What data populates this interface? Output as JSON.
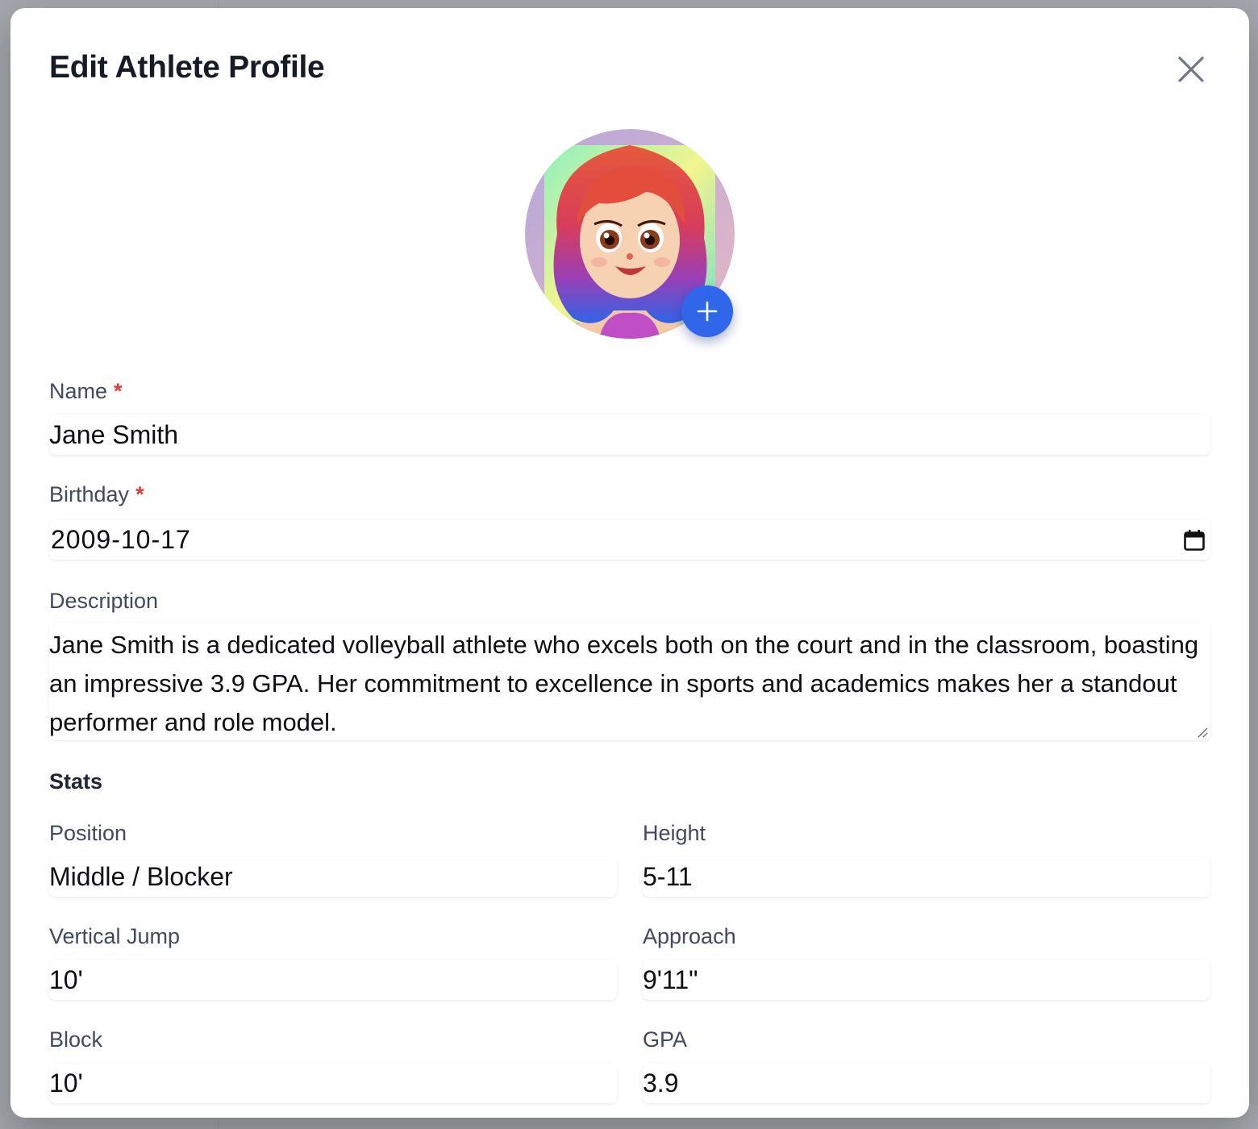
{
  "modal": {
    "title": "Edit Athlete Profile"
  },
  "avatar": {
    "add_icon": "plus-icon",
    "close_icon": "close-icon"
  },
  "form": {
    "name": {
      "label": "Name",
      "required_mark": "*",
      "value": "Jane Smith"
    },
    "birthday": {
      "label": "Birthday",
      "required_mark": "*",
      "value": "2009-10-17",
      "icon": "calendar-icon"
    },
    "description": {
      "label": "Description",
      "value": "Jane Smith is a dedicated volleyball athlete who excels both on the court and in the classroom, boasting an impressive 3.9 GPA. Her commitment to excellence in sports and academics makes her a standout performer and role model."
    }
  },
  "stats": {
    "title": "Stats",
    "position": {
      "label": "Position",
      "value": "Middle / Blocker"
    },
    "height": {
      "label": "Height",
      "value": "5-11"
    },
    "vertical_jump": {
      "label": "Vertical Jump",
      "value": "10'"
    },
    "approach": {
      "label": "Approach",
      "value": "9'11\""
    },
    "block": {
      "label": "Block",
      "value": "10'"
    },
    "gpa": {
      "label": "GPA",
      "value": "3.9"
    }
  },
  "colors": {
    "accent": "#3066ea",
    "required": "#e03a3a"
  }
}
